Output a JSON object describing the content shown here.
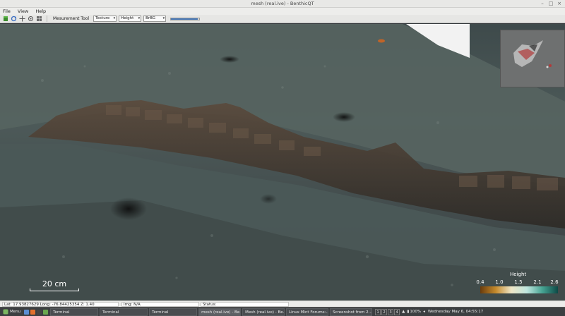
{
  "window": {
    "title": "mesh (real.ive) - BenthicQT"
  },
  "menu": [
    "File",
    "View",
    "Help"
  ],
  "toolbar": {
    "measurement_label": "Mesurement Tool",
    "selects": [
      {
        "value": "Texture"
      },
      {
        "value": "Height"
      },
      {
        "value": "BrBG"
      }
    ],
    "slider_fraction": 0.95
  },
  "viewport": {
    "scale_label": "20 cm",
    "legend": {
      "title": "Height",
      "ticks": [
        "0.4",
        "1.0",
        "1.5",
        "2.1",
        "2.6"
      ],
      "colormap": "BrBG"
    }
  },
  "status": {
    "coords": "Lat: 17.93827629 Long: -76.84425354 Z: 1.40",
    "img": "Img: N/A",
    "status": "Status:"
  },
  "taskbar": {
    "menu_label": "Menu",
    "items": [
      {
        "label": "Terminal",
        "active": false
      },
      {
        "label": "Terminal",
        "active": false
      },
      {
        "label": "Terminal",
        "active": false
      },
      {
        "label": "mesh (real.ive) - Be...",
        "active": true
      },
      {
        "label": "Mesh (real.ive) - Be...",
        "active": false
      },
      {
        "label": "Linux Mint Forums:...",
        "active": false
      },
      {
        "label": "Screenshot from 2...",
        "active": false
      }
    ],
    "workspaces": [
      "1",
      "2",
      "3",
      "4"
    ],
    "battery": "100%",
    "clock": "Wednesday May 6, 04:55:17"
  }
}
